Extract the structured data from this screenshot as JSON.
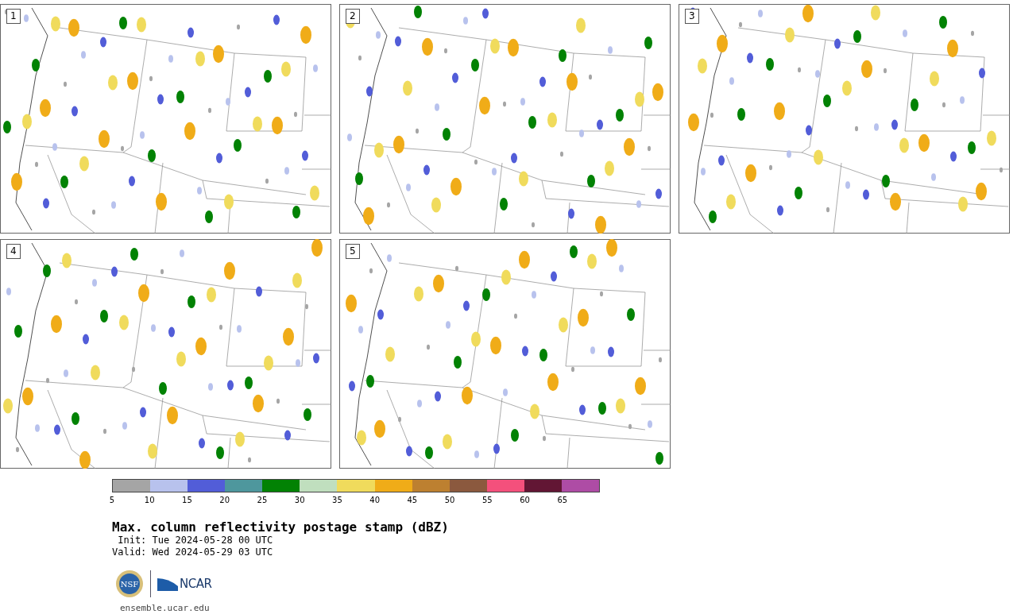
{
  "panels": [
    {
      "label": "1"
    },
    {
      "label": "2"
    },
    {
      "label": "3"
    },
    {
      "label": "4"
    },
    {
      "label": "5"
    }
  ],
  "colorbar": {
    "segments": [
      {
        "color": "#a5a5a5",
        "tick": "5"
      },
      {
        "color": "#b8c2ed",
        "tick": "10"
      },
      {
        "color": "#525dd8",
        "tick": "15"
      },
      {
        "color": "#4e979d",
        "tick": "20"
      },
      {
        "color": "#028204",
        "tick": "25"
      },
      {
        "color": "#c0dfbe",
        "tick": "30"
      },
      {
        "color": "#f0db5c",
        "tick": "35"
      },
      {
        "color": "#f0ac18",
        "tick": "40"
      },
      {
        "color": "#bd8030",
        "tick": "45"
      },
      {
        "color": "#8b593e",
        "tick": "50"
      },
      {
        "color": "#f4507c",
        "tick": "55"
      },
      {
        "color": "#621634",
        "tick": "60"
      },
      {
        "color": "#ae4ca5",
        "tick": "65"
      }
    ]
  },
  "title": "Max. column reflectivity postage stamp (dBZ)",
  "init": " Init: Tue 2024-05-28 00 UTC",
  "valid": "Valid: Wed 2024-05-29 03 UTC",
  "logos": {
    "nsf": "NSF",
    "ncar": "NCAR"
  },
  "footer": "ensemble.ucar.edu"
}
